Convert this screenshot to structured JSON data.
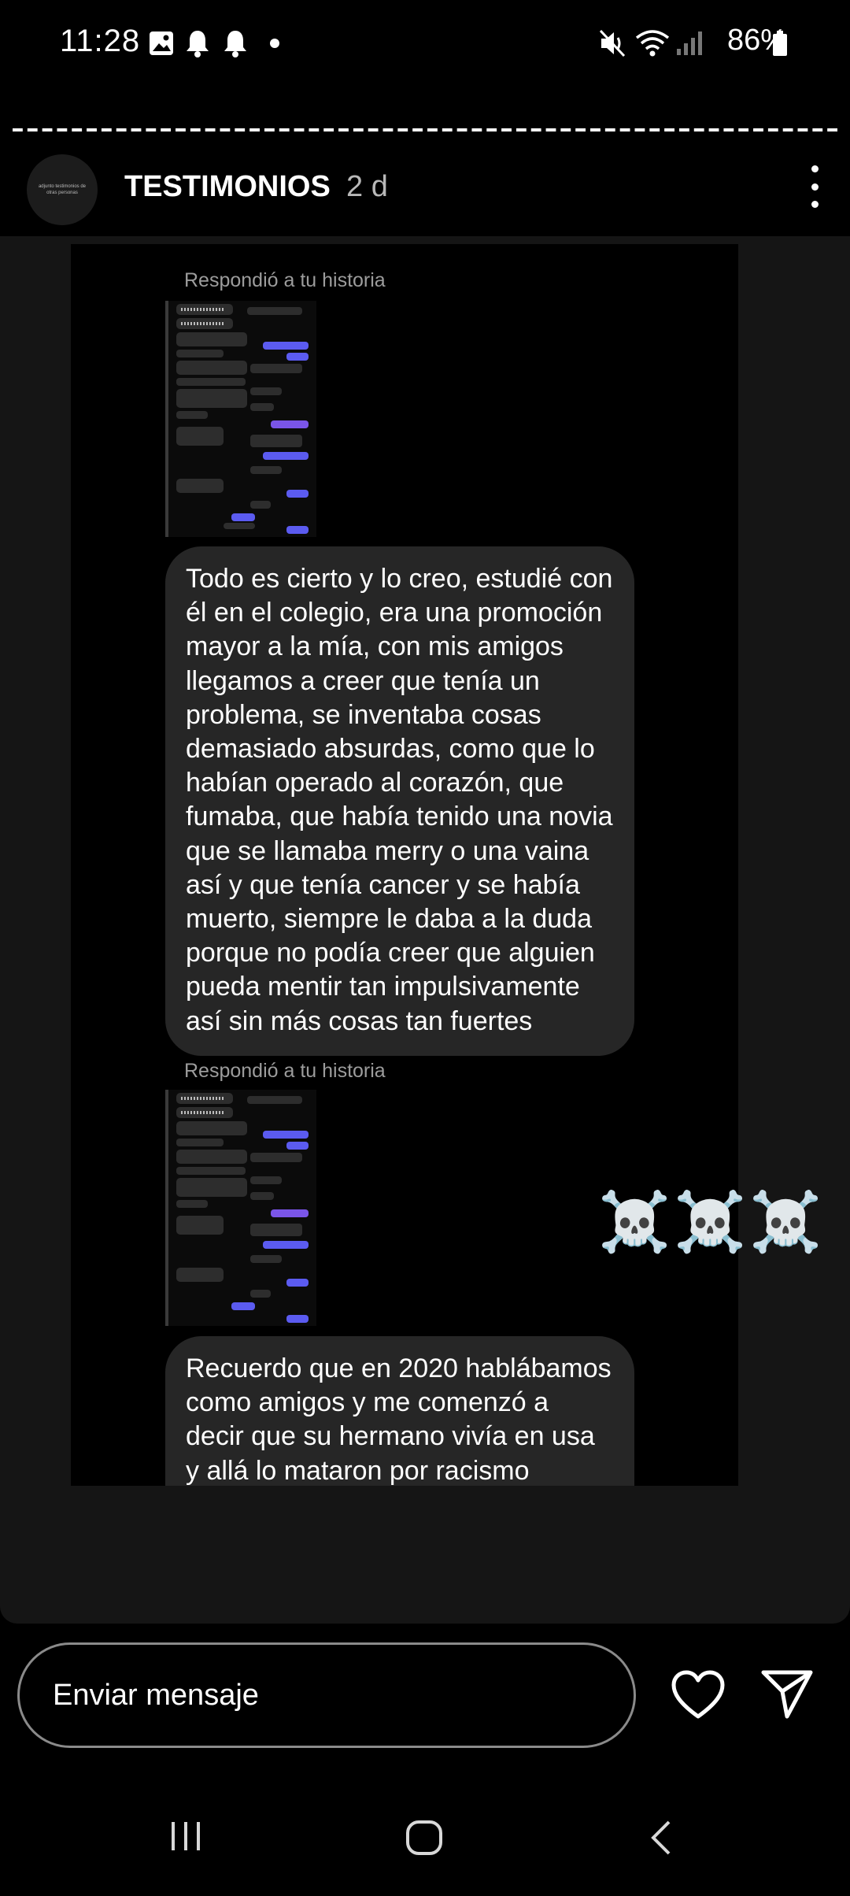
{
  "status_bar": {
    "time": "11:28",
    "battery": "86%",
    "icons": [
      "gallery-icon",
      "bell-icon",
      "bell-icon",
      "dot-icon",
      "mute-icon",
      "wifi-icon",
      "signal-icon",
      "battery-icon"
    ]
  },
  "story": {
    "username": "TESTIMONIOS",
    "time_ago": "2 d",
    "avatar_text": "adjunto testimonios de otras personas",
    "progress_segments": 56
  },
  "conversation": {
    "reply_label_1": "Respondió a tu historia",
    "message_1": "Todo es cierto y lo creo, estudié con él en el colegio, era una promoción mayor a la mía, con mis amigos llegamos a creer que tenía un problema, se inventaba cosas demasiado absurdas, como que lo habían operado al corazón, que fumaba, que había tenido una novia que se llamaba merry o una vaina así y que tenía cancer y se había muerto, siempre le daba a la duda porque no podía creer que alguien pueda mentir tan impulsivamente así sin más cosas tan fuertes",
    "reply_label_2": "Respondió a tu historia",
    "emoji_text": "☠️☠️☠️",
    "message_2": "Recuerdo que en 2020 hablábamos como amigos y me comenzó a decir que su hermano vivía en usa y allá lo mataron por racismo"
  },
  "composer": {
    "placeholder": "Enviar mensaje"
  },
  "nav": [
    "recents-icon",
    "home-icon",
    "back-icon"
  ],
  "colors": {
    "background": "#000000",
    "bubble": "#262626",
    "card": "#151515",
    "outgoing": "#5b5bf0"
  }
}
